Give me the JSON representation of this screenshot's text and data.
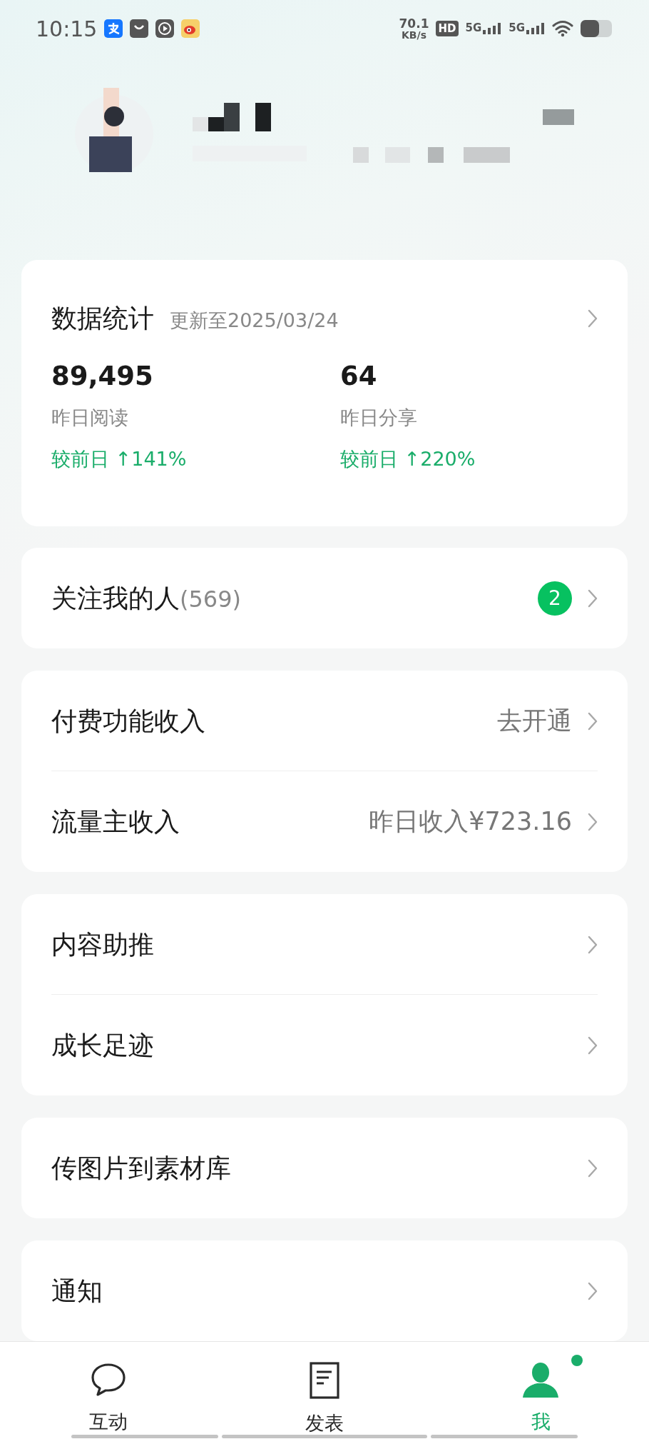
{
  "status_bar": {
    "time": "10:15",
    "speed": "70.1",
    "speed_unit": "KB/s",
    "hd": "HD",
    "sims": [
      "5G",
      "5G"
    ]
  },
  "stats": {
    "title": "数据统计",
    "updated": "更新至2025/03/24",
    "metrics": [
      {
        "value": "89,495",
        "label": "昨日阅读",
        "change": "较前日 ↑141%"
      },
      {
        "value": "64",
        "label": "昨日分享",
        "change": "较前日 ↑220%"
      }
    ]
  },
  "groups": [
    {
      "rows": [
        {
          "label": "关注我的人",
          "count": "(569)",
          "badge": "2"
        }
      ]
    },
    {
      "rows": [
        {
          "label": "付费功能收入",
          "value": "去开通"
        },
        {
          "label": "流量主收入",
          "value": "昨日收入¥723.16"
        }
      ]
    },
    {
      "rows": [
        {
          "label": "内容助推"
        },
        {
          "label": "成长足迹"
        }
      ]
    },
    {
      "rows": [
        {
          "label": "传图片到素材库"
        }
      ]
    },
    {
      "rows": [
        {
          "label": "通知"
        }
      ]
    }
  ],
  "nav": [
    {
      "label": "互动",
      "selected": false,
      "dot": false
    },
    {
      "label": "发表",
      "selected": false,
      "dot": false
    },
    {
      "label": "我",
      "selected": true,
      "dot": true
    }
  ]
}
